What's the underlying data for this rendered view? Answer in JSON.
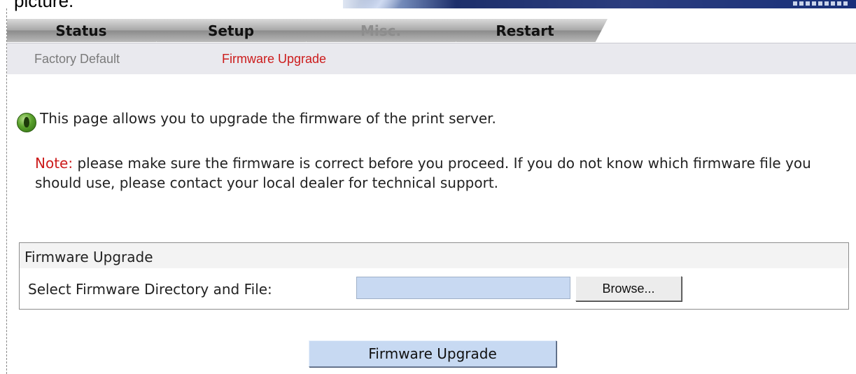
{
  "top_caption": "picture.",
  "tabs": [
    {
      "label": "Status",
      "state": "normal"
    },
    {
      "label": "Setup",
      "state": "normal"
    },
    {
      "label": "Misc.",
      "state": "selected"
    },
    {
      "label": "Restart",
      "state": "normal"
    }
  ],
  "subnav": {
    "items": [
      {
        "label": "Factory Default",
        "active": false
      },
      {
        "label": "Firmware Upgrade",
        "active": true
      }
    ]
  },
  "content": {
    "intro": "This page allows you to upgrade the firmware of the print server.",
    "note_label": "Note:",
    "note_text": " please make sure the firmware is correct before you proceed. If you do not know which firmware file you should use, please contact your local dealer for technical support."
  },
  "firmware_box": {
    "title": "Firmware Upgrade",
    "field_label": "Select Firmware Directory and File:",
    "field_value": "",
    "browse_label": "Browse..."
  },
  "submit_label": "Firmware Upgrade",
  "colors": {
    "accent_red": "#cc1b1b",
    "input_bg": "#c8d9f2",
    "subnav_bg": "#e9e9ee"
  },
  "icons": {
    "info": "info-icon"
  }
}
